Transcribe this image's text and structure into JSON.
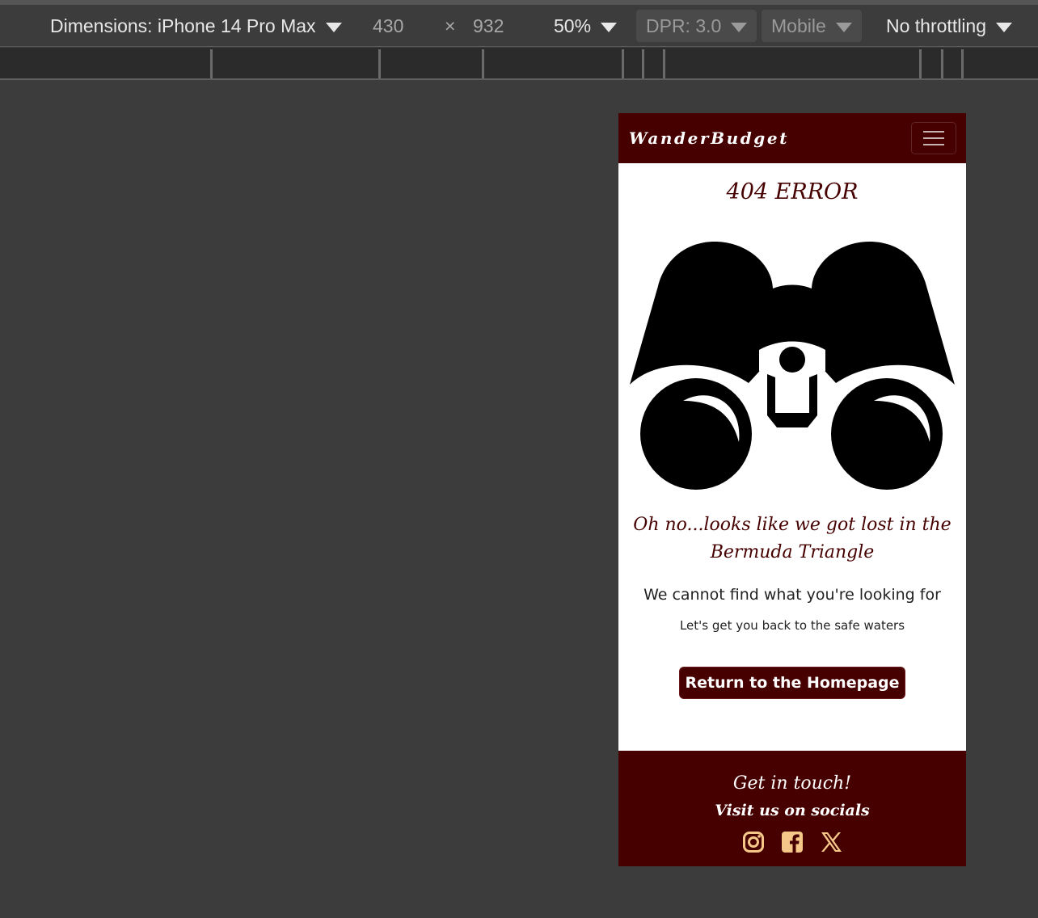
{
  "devtools": {
    "dimensions_label": "Dimensions: iPhone 14 Pro Max",
    "width": "430",
    "times": "×",
    "height": "932",
    "zoom": "50%",
    "dpr": "DPR: 3.0",
    "device_type": "Mobile",
    "throttling": "No throttling"
  },
  "page": {
    "brand": "WanderBudget",
    "error_title": "404 ERROR",
    "lost_message": "Oh no...looks like we got lost in the Bermuda Triangle",
    "cannot_find": "We cannot find what you're looking for",
    "safe_waters": "Let's get you back to the safe waters",
    "home_button": "Return to the Homepage",
    "footer_title": "Get in touch!",
    "footer_subtitle": "Visit us on socials",
    "social_icons": [
      "instagram-icon",
      "facebook-icon",
      "x-icon"
    ]
  },
  "colors": {
    "brand_maroon": "#460000",
    "social_icon": "#f5c88a",
    "devtools_bg": "#3c3c3c"
  }
}
